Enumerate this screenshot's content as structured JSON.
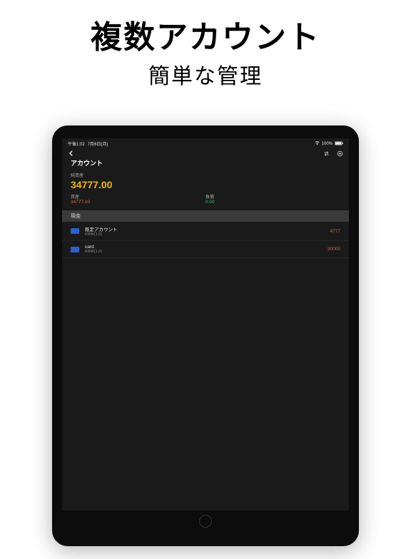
{
  "promo": {
    "title": "複数アカウント",
    "subtitle": "簡単な管理"
  },
  "status": {
    "time": "午後1:02",
    "date": "7月6日(月)",
    "battery": "100%"
  },
  "nav": {
    "page_title": "アカウント"
  },
  "summary": {
    "net_label": "純資産",
    "net_value": "34777.00",
    "assets_label": "資産",
    "assets_value": "34777.00",
    "liab_label": "負債",
    "liab_value": "0.00"
  },
  "section": {
    "cash_label": "現金"
  },
  "accounts": [
    {
      "name": "既定アカウント",
      "sub": "KRW(1.0)",
      "amount": "4777"
    },
    {
      "name": "card",
      "sub": "KRW(1.0)",
      "amount": "30000"
    }
  ]
}
